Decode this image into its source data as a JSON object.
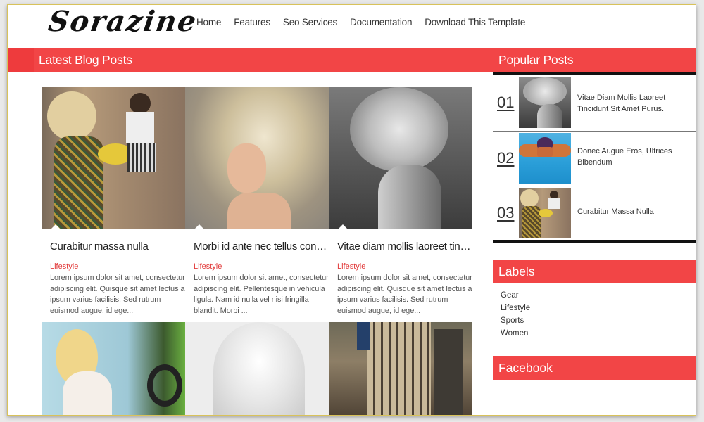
{
  "site": {
    "logo": "Sorazine",
    "nav": [
      "Home",
      "Features",
      "Seo Services",
      "Documentation",
      "Download This Template"
    ]
  },
  "main": {
    "section_title": "Latest Blog Posts",
    "posts": [
      {
        "title": "Curabitur massa nulla",
        "category": "Lifestyle",
        "excerpt": "Lorem ipsum dolor sit amet, consectetur adipiscing elit. Quisque sit amet lectus a ipsum varius facilisis. Sed rutrum euismod augue, id ege...",
        "image": "woman-blonde-vintage-with-bicycle"
      },
      {
        "title": "Morbi id ante nec tellus conval...",
        "category": "Lifestyle",
        "excerpt": "Lorem ipsum dolor sit amet, consectetur adipiscing elit. Pellentesque in vehicula ligula. Nam id nulla vel nisi fringilla blandit. Morbi ...",
        "image": "woman-feathered-hair"
      },
      {
        "title": "Vitae diam mollis laoreet tinci...",
        "category": "Lifestyle",
        "excerpt": "Lorem ipsum dolor sit amet, consectetur adipiscing elit. Quisque sit amet lectus a ipsum varius facilisis. Sed rutrum euismod augue, id ege...",
        "image": "woman-curly-hair-monochrome"
      }
    ],
    "second_row_images": [
      "woman-with-blue-car",
      "white-braided-hair",
      "city-flatiron-building"
    ]
  },
  "sidebar": {
    "popular_title": "Popular Posts",
    "popular": [
      {
        "num": "01",
        "title": "Vitae Diam Mollis Laoreet Tincidunt Sit Amet Purus.",
        "image": "woman-curly-hair-monochrome"
      },
      {
        "num": "02",
        "title": "Donec Augue Eros, Ultrices Bibendum",
        "image": "swimmer"
      },
      {
        "num": "03",
        "title": "Curabitur Massa Nulla",
        "image": "woman-blonde-vintage-with-bicycle"
      }
    ],
    "labels_title": "Labels",
    "labels": [
      "Gear",
      "Lifestyle",
      "Sports",
      "Women"
    ],
    "facebook_title": "Facebook"
  },
  "colors": {
    "accent": "#f24546",
    "category": "#e23b3b",
    "frame_border": "#d8c25a"
  }
}
